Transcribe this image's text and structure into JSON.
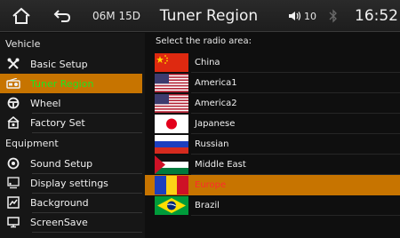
{
  "topbar": {
    "date": "06M 15D",
    "title": "Tuner Region",
    "volume": "10",
    "clock": "16:52"
  },
  "sidebar": {
    "sections": [
      {
        "label": "Vehicle",
        "items": [
          {
            "label": "Basic Setup",
            "icon": "tools-icon"
          },
          {
            "label": "Tuner Region",
            "icon": "radio-icon",
            "selected": true
          },
          {
            "label": "Wheel",
            "icon": "steering-wheel-icon"
          },
          {
            "label": "Factory Set",
            "icon": "factory-icon"
          }
        ]
      },
      {
        "label": "Equipment",
        "items": [
          {
            "label": "Sound Setup",
            "icon": "sound-icon"
          },
          {
            "label": "Display settings",
            "icon": "display-icon"
          },
          {
            "label": "Background",
            "icon": "background-icon"
          },
          {
            "label": "ScreenSave",
            "icon": "screensave-icon"
          }
        ]
      }
    ]
  },
  "main": {
    "prompt": "Select the radio area:",
    "regions": [
      {
        "name": "China",
        "flag": "china-flag-icon"
      },
      {
        "name": "America1",
        "flag": "usa-flag-icon"
      },
      {
        "name": "America2",
        "flag": "usa-flag-icon"
      },
      {
        "name": "Japanese",
        "flag": "japan-flag-icon"
      },
      {
        "name": "Russian",
        "flag": "russia-flag-icon"
      },
      {
        "name": "Middle East",
        "flag": "middle-east-flag-icon"
      },
      {
        "name": "Europe",
        "flag": "europe-flag-icon",
        "selected": true
      },
      {
        "name": "Brazil",
        "flag": "brazil-flag-icon"
      }
    ]
  },
  "colors": {
    "selection": "#c77400",
    "selected_sidebar_text": "#1fe41f",
    "selected_region_text": "#ff2b2b"
  }
}
